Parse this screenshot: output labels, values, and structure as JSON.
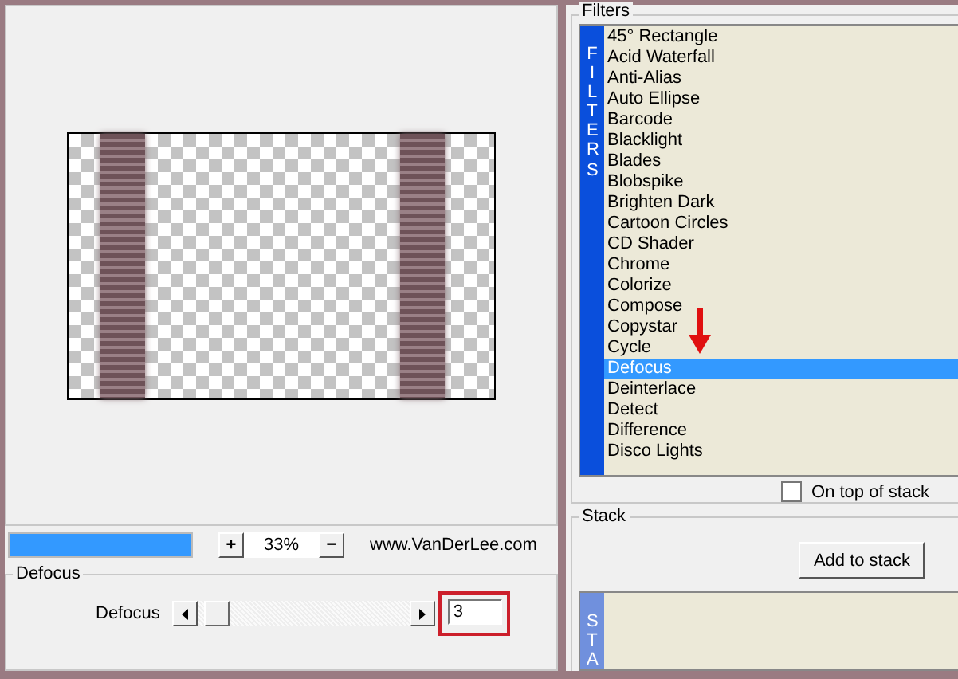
{
  "preview": {
    "progress": {
      "level": 1
    },
    "zoom_in": "+",
    "zoom_percent": "33%",
    "zoom_out": "−",
    "website": "www.VanDerLee.com"
  },
  "defocus_group": {
    "title": "Defocus",
    "label": "Defocus",
    "slider": {
      "level": 0.03
    },
    "value": "3"
  },
  "filters": {
    "title": "Filters",
    "strip_label": "FILTERS",
    "items": [
      {
        "label": "45° Rectangle",
        "selected": false
      },
      {
        "label": "Acid Waterfall",
        "selected": false
      },
      {
        "label": "Anti-Alias",
        "selected": false
      },
      {
        "label": "Auto Ellipse",
        "selected": false
      },
      {
        "label": "Barcode",
        "selected": false
      },
      {
        "label": "Blacklight",
        "selected": false
      },
      {
        "label": "Blades",
        "selected": false
      },
      {
        "label": "Blobspike",
        "selected": false
      },
      {
        "label": "Brighten Dark",
        "selected": false
      },
      {
        "label": "Cartoon Circles",
        "selected": false
      },
      {
        "label": "CD Shader",
        "selected": false
      },
      {
        "label": "Chrome",
        "selected": false
      },
      {
        "label": "Colorize",
        "selected": false
      },
      {
        "label": "Compose",
        "selected": false
      },
      {
        "label": "Copystar",
        "selected": false
      },
      {
        "label": "Cycle",
        "selected": false
      },
      {
        "label": "Defocus",
        "selected": true
      },
      {
        "label": "Deinterlace",
        "selected": false
      },
      {
        "label": "Detect",
        "selected": false
      },
      {
        "label": "Difference",
        "selected": false
      },
      {
        "label": "Disco Lights",
        "selected": false
      }
    ],
    "on_top_of_stack": {
      "label": "On top of stack",
      "checked": false
    }
  },
  "stack": {
    "title": "Stack",
    "add_button": "Add to stack",
    "strip_label": "STA"
  }
}
